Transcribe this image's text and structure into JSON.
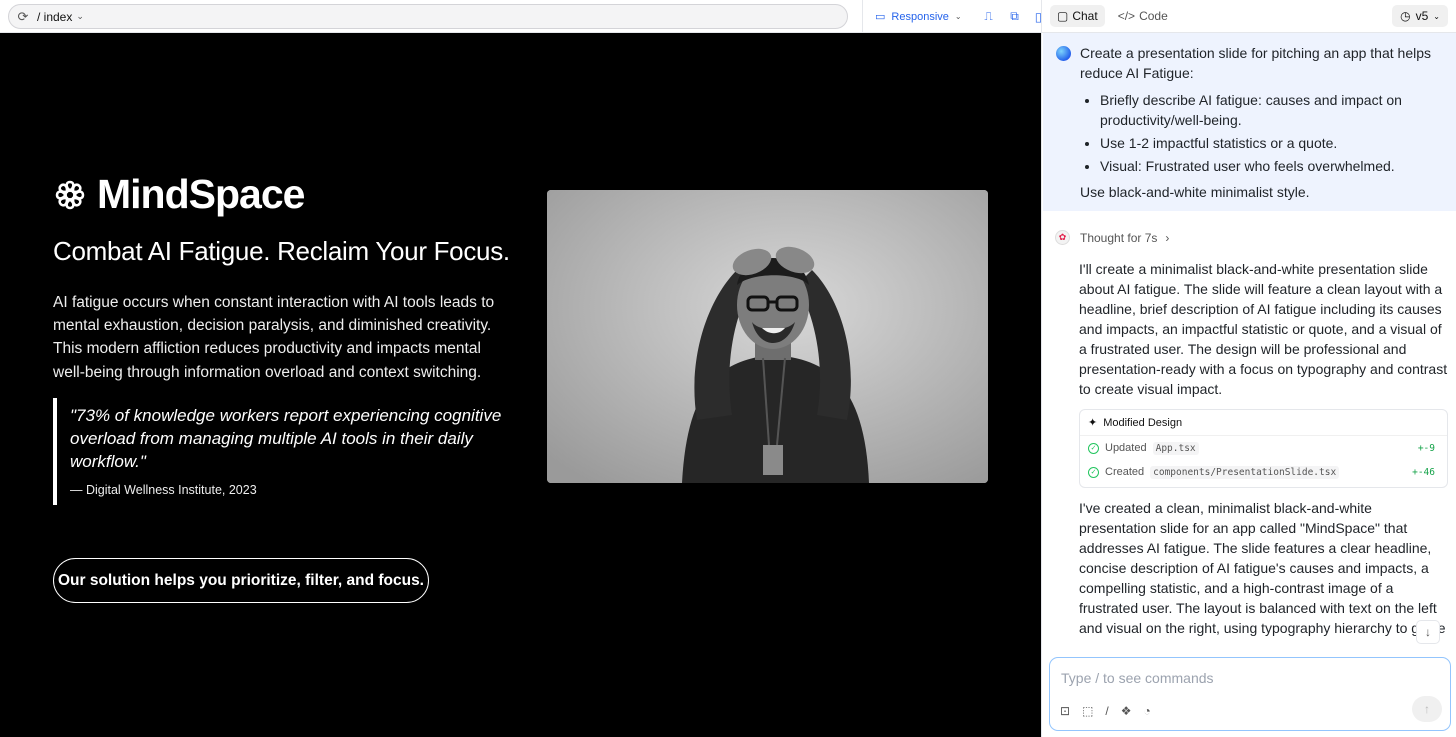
{
  "preview": {
    "url": "/ index",
    "responsive_label": "Responsive"
  },
  "slide": {
    "brand": "MindSpace",
    "headline": "Combat AI Fatigue. Reclaim Your Focus.",
    "description": "AI fatigue occurs when constant interaction with AI tools leads to mental exhaustion, decision paralysis, and diminished creativity. This modern affliction reduces productivity and impacts mental well-being through information overload and context switching.",
    "quote": "\"73% of knowledge workers report experiencing cognitive overload from managing multiple AI tools in their daily workflow.\"",
    "quote_source": "— Digital Wellness Institute, 2023",
    "cta": "Our solution helps you prioritize, filter, and focus.",
    "image_desc_icon": "frustrated-person-photo"
  },
  "chat": {
    "tabs": [
      "Chat",
      "Code"
    ],
    "version": "v5",
    "user_message": {
      "intro": "Create a presentation slide for pitching an app that helps reduce AI Fatigue:",
      "bullets": [
        "Briefly describe AI fatigue: causes and impact on productivity/well-being.",
        "Use 1-2 impactful statistics or a quote.",
        "Visual: Frustrated user who feels overwhelmed."
      ],
      "outro": "Use black-and-white minimalist style."
    },
    "thought_label": "Thought for 7s",
    "reply_1": "I'll create a minimalist black-and-white presentation slide about AI fatigue. The slide will feature a clean layout with a headline, brief description of AI fatigue including its causes and impacts, an impactful statistic or quote, and a visual of a frustrated user. The design will be professional and presentation-ready with a focus on typography and contrast to create visual impact.",
    "card": {
      "title": "Modified Design",
      "rows": [
        {
          "action": "Updated",
          "file": "App.tsx",
          "diff": "+-9"
        },
        {
          "action": "Created",
          "file": "components/PresentationSlide.tsx",
          "diff": "+-46"
        }
      ]
    },
    "reply_2": "I've created a clean, minimalist black-and-white presentation slide for an app called \"MindSpace\" that addresses AI fatigue. The slide features a clear headline, concise description of AI fatigue's causes and impacts, a compelling statistic, and a high-contrast image of a frustrated user. The layout is balanced with text on the left and visual on the right, using typography hierarchy to guide the viewer's attention.",
    "input_placeholder": "Type / to see commands"
  }
}
